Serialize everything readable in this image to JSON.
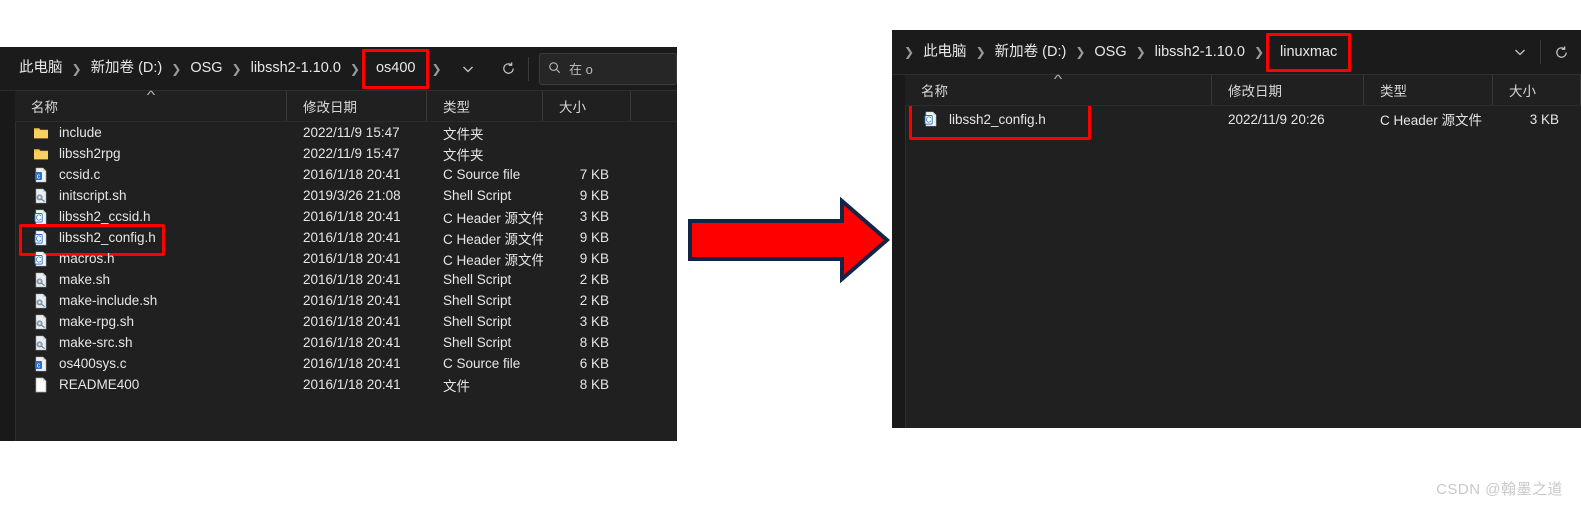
{
  "left_window": {
    "address": {
      "crumbs": [
        {
          "label": "此电脑",
          "highlighted": false
        },
        {
          "label": "新加卷 (D:)",
          "highlighted": false
        },
        {
          "label": "OSG",
          "highlighted": false
        },
        {
          "label": "libssh2-1.10.0",
          "highlighted": false
        },
        {
          "label": "os400",
          "highlighted": true
        }
      ],
      "dropdown_icon": "chevron-down-icon",
      "refresh_icon": "refresh-icon",
      "search_icon": "search-icon",
      "search_placeholder": "在 o"
    },
    "columns": [
      "名称",
      "修改日期",
      "类型",
      "大小"
    ],
    "sorted_column": "名称",
    "rows": [
      {
        "icon": "folder-icon",
        "name": "include",
        "date": "2022/11/9 15:47",
        "type": "文件夹",
        "size": "",
        "highlighted": false
      },
      {
        "icon": "folder-icon",
        "name": "libssh2rpg",
        "date": "2022/11/9 15:47",
        "type": "文件夹",
        "size": "",
        "highlighted": false
      },
      {
        "icon": "c-source-icon",
        "name": "ccsid.c",
        "date": "2016/1/18 20:41",
        "type": "C Source file",
        "size": "7 KB",
        "highlighted": false
      },
      {
        "icon": "shell-icon",
        "name": "initscript.sh",
        "date": "2019/3/26 21:08",
        "type": "Shell Script",
        "size": "9 KB",
        "highlighted": false
      },
      {
        "icon": "c-header-icon",
        "name": "libssh2_ccsid.h",
        "date": "2016/1/18 20:41",
        "type": "C Header 源文件",
        "size": "3 KB",
        "highlighted": false
      },
      {
        "icon": "c-header-icon",
        "name": "libssh2_config.h",
        "date": "2016/1/18 20:41",
        "type": "C Header 源文件",
        "size": "9 KB",
        "highlighted": true
      },
      {
        "icon": "c-header-icon",
        "name": "macros.h",
        "date": "2016/1/18 20:41",
        "type": "C Header 源文件",
        "size": "9 KB",
        "highlighted": false
      },
      {
        "icon": "shell-icon",
        "name": "make.sh",
        "date": "2016/1/18 20:41",
        "type": "Shell Script",
        "size": "2 KB",
        "highlighted": false
      },
      {
        "icon": "shell-icon",
        "name": "make-include.sh",
        "date": "2016/1/18 20:41",
        "type": "Shell Script",
        "size": "2 KB",
        "highlighted": false
      },
      {
        "icon": "shell-icon",
        "name": "make-rpg.sh",
        "date": "2016/1/18 20:41",
        "type": "Shell Script",
        "size": "3 KB",
        "highlighted": false
      },
      {
        "icon": "shell-icon",
        "name": "make-src.sh",
        "date": "2016/1/18 20:41",
        "type": "Shell Script",
        "size": "8 KB",
        "highlighted": false
      },
      {
        "icon": "c-source-icon",
        "name": "os400sys.c",
        "date": "2016/1/18 20:41",
        "type": "C Source file",
        "size": "6 KB",
        "highlighted": false
      },
      {
        "icon": "file-icon",
        "name": "README400",
        "date": "2016/1/18 20:41",
        "type": "文件",
        "size": "8 KB",
        "highlighted": false
      }
    ]
  },
  "right_window": {
    "address": {
      "crumbs": [
        {
          "label": "此电脑",
          "highlighted": false
        },
        {
          "label": "新加卷 (D:)",
          "highlighted": false
        },
        {
          "label": "OSG",
          "highlighted": false
        },
        {
          "label": "libssh2-1.10.0",
          "highlighted": false
        },
        {
          "label": "linuxmac",
          "highlighted": true
        }
      ],
      "dropdown_icon": "chevron-down-icon",
      "refresh_icon": "refresh-icon"
    },
    "columns": [
      "名称",
      "修改日期",
      "类型",
      "大小"
    ],
    "sorted_column": "名称",
    "rows": [
      {
        "icon": "c-header-icon",
        "name": "libssh2_config.h",
        "date": "2022/11/9 20:26",
        "type": "C Header 源文件",
        "size": "3 KB",
        "highlighted": true
      }
    ]
  },
  "arrow": {
    "name": "right-arrow",
    "fill": "#fe0000",
    "stroke": "#122447"
  },
  "watermark": {
    "text": "CSDN @翰墨之道"
  },
  "theme": {
    "panel_bg": "#202020",
    "addressbar_bg": "#1b1b1b",
    "text": "#e6e6e6",
    "highlight": "#ff0000",
    "folder": "#f0c040"
  }
}
